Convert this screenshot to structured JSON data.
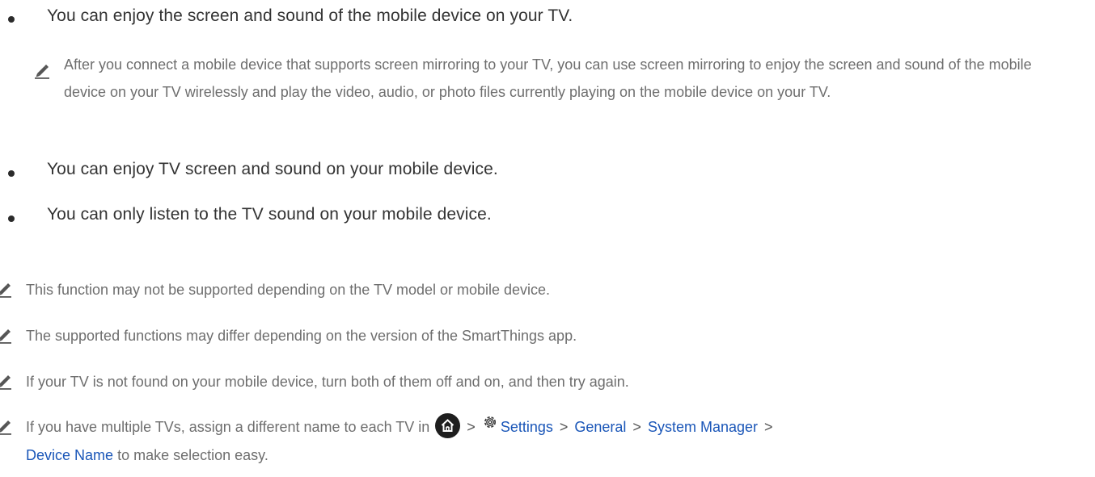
{
  "bullets": [
    {
      "text": "You can enjoy the screen and sound of the mobile device on your TV."
    },
    {
      "text": "You can enjoy TV screen and sound on your mobile device."
    },
    {
      "text": "You can only listen to the TV sound on your mobile device."
    }
  ],
  "nested_note": {
    "icon": "pencil-icon",
    "text": "After you connect a mobile device that supports screen mirroring to your TV, you can use screen mirroring to enjoy the screen and sound of the mobile device on your TV wirelessly and play the video, audio, or photo files currently playing on the mobile device on your TV."
  },
  "notes": [
    {
      "icon": "pencil-icon",
      "text": "This function may not be supported depending on the TV model or mobile device."
    },
    {
      "icon": "pencil-icon",
      "text": "The supported functions may differ depending on the version of the SmartThings app."
    },
    {
      "icon": "pencil-icon",
      "text": "If your TV is not found on your mobile device, turn both of them off and on, and then try again."
    }
  ],
  "last_note": {
    "icon": "pencil-icon",
    "prefix": "If you have multiple TVs, assign a different name to each TV in",
    "home_icon": "home-icon",
    "settings_icon": "gear-icon",
    "path": [
      "Settings",
      "General",
      "System Manager",
      "Device Name"
    ],
    "separator": ">",
    "suffix": "to make selection easy."
  },
  "colors": {
    "link": "#1a56b8",
    "bullet_text": "#333333",
    "note_text": "#6e6e6e"
  }
}
